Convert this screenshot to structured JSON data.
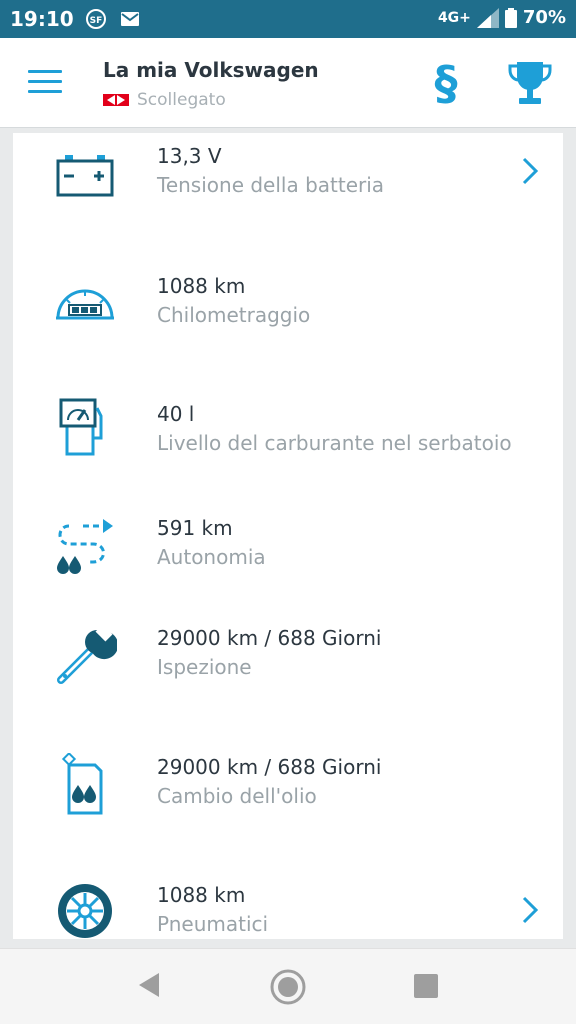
{
  "status_bar": {
    "time": "19:10",
    "network": "4G+",
    "battery": "70%",
    "icons": [
      "sim-icon",
      "mail-icon",
      "signal-icon",
      "battery-icon"
    ]
  },
  "header": {
    "title": "La mia Volkswagen",
    "connection_status": "Scollegato",
    "icons": [
      "menu-icon",
      "paragraph-icon",
      "trophy-icon"
    ]
  },
  "vehicle_status": [
    {
      "value": "13,3 V",
      "label": "Tensione della batteria",
      "icon": "battery-icon",
      "has_chevron": true
    },
    {
      "value": "1088 km",
      "label": "Chilometraggio",
      "icon": "odometer-icon",
      "has_chevron": false
    },
    {
      "value": "40 l",
      "label": "Livello del carburante nel serbatoio",
      "icon": "fuel-pump-icon",
      "has_chevron": false
    },
    {
      "value": "591 km",
      "label": "Autonomia",
      "icon": "range-icon",
      "has_chevron": false
    },
    {
      "value": "29000 km / 688 Giorni",
      "label": "Ispezione",
      "icon": "wrench-icon",
      "has_chevron": false
    },
    {
      "value": "29000 km / 688 Giorni",
      "label": "Cambio dell'olio",
      "icon": "oil-can-icon",
      "has_chevron": false
    },
    {
      "value": "1088 km",
      "label": "Pneumatici",
      "icon": "tire-icon",
      "has_chevron": true
    }
  ],
  "colors": {
    "accent": "#1e9fd7",
    "status_bar": "#1f6e8c",
    "icon_dark": "#155a73",
    "text_primary": "#2c3740",
    "text_secondary": "#9aa3a8"
  }
}
